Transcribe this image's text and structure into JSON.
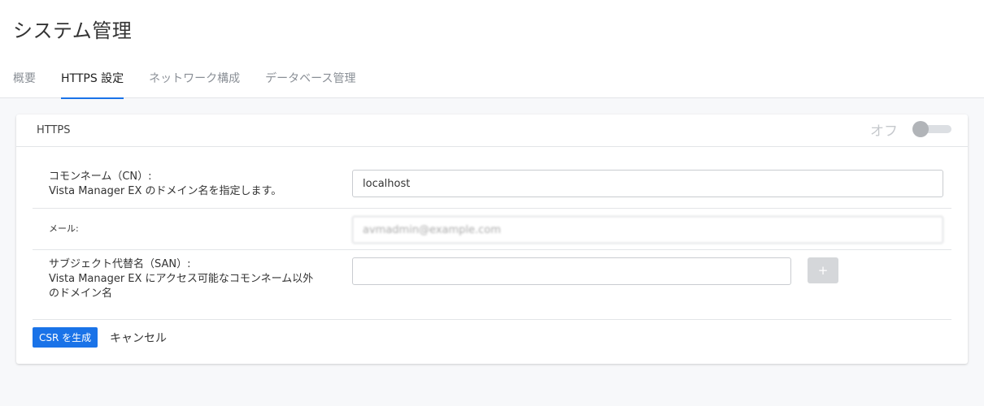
{
  "header": {
    "title": "システム管理",
    "tabs": [
      {
        "label": "概要",
        "active": false
      },
      {
        "label": "HTTPS 設定",
        "active": true
      },
      {
        "label": "ネットワーク構成",
        "active": false
      },
      {
        "label": "データベース管理",
        "active": false
      }
    ]
  },
  "https_card": {
    "title": "HTTPS",
    "toggle_label": "オフ",
    "toggle_on": false
  },
  "form": {
    "common_name": {
      "label_line1": "コモンネーム（CN）:",
      "label_line2": "Vista Manager EX のドメイン名を指定します。",
      "value": "localhost"
    },
    "email": {
      "label": "メール:",
      "value": "avmadmin@example.com"
    },
    "san": {
      "label_line1": "サブジェクト代替名（SAN）:",
      "label_line2": "Vista Manager EX にアクセス可能なコモンネーム以外",
      "label_line3": "のドメイン名",
      "value": "",
      "add_label": "+"
    }
  },
  "actions": {
    "generate_label": "CSR を生成",
    "cancel_label": "キャンセル"
  },
  "colors": {
    "accent": "#1a73e8",
    "background": "#f7f8fa",
    "border": "#e3e5e8"
  }
}
